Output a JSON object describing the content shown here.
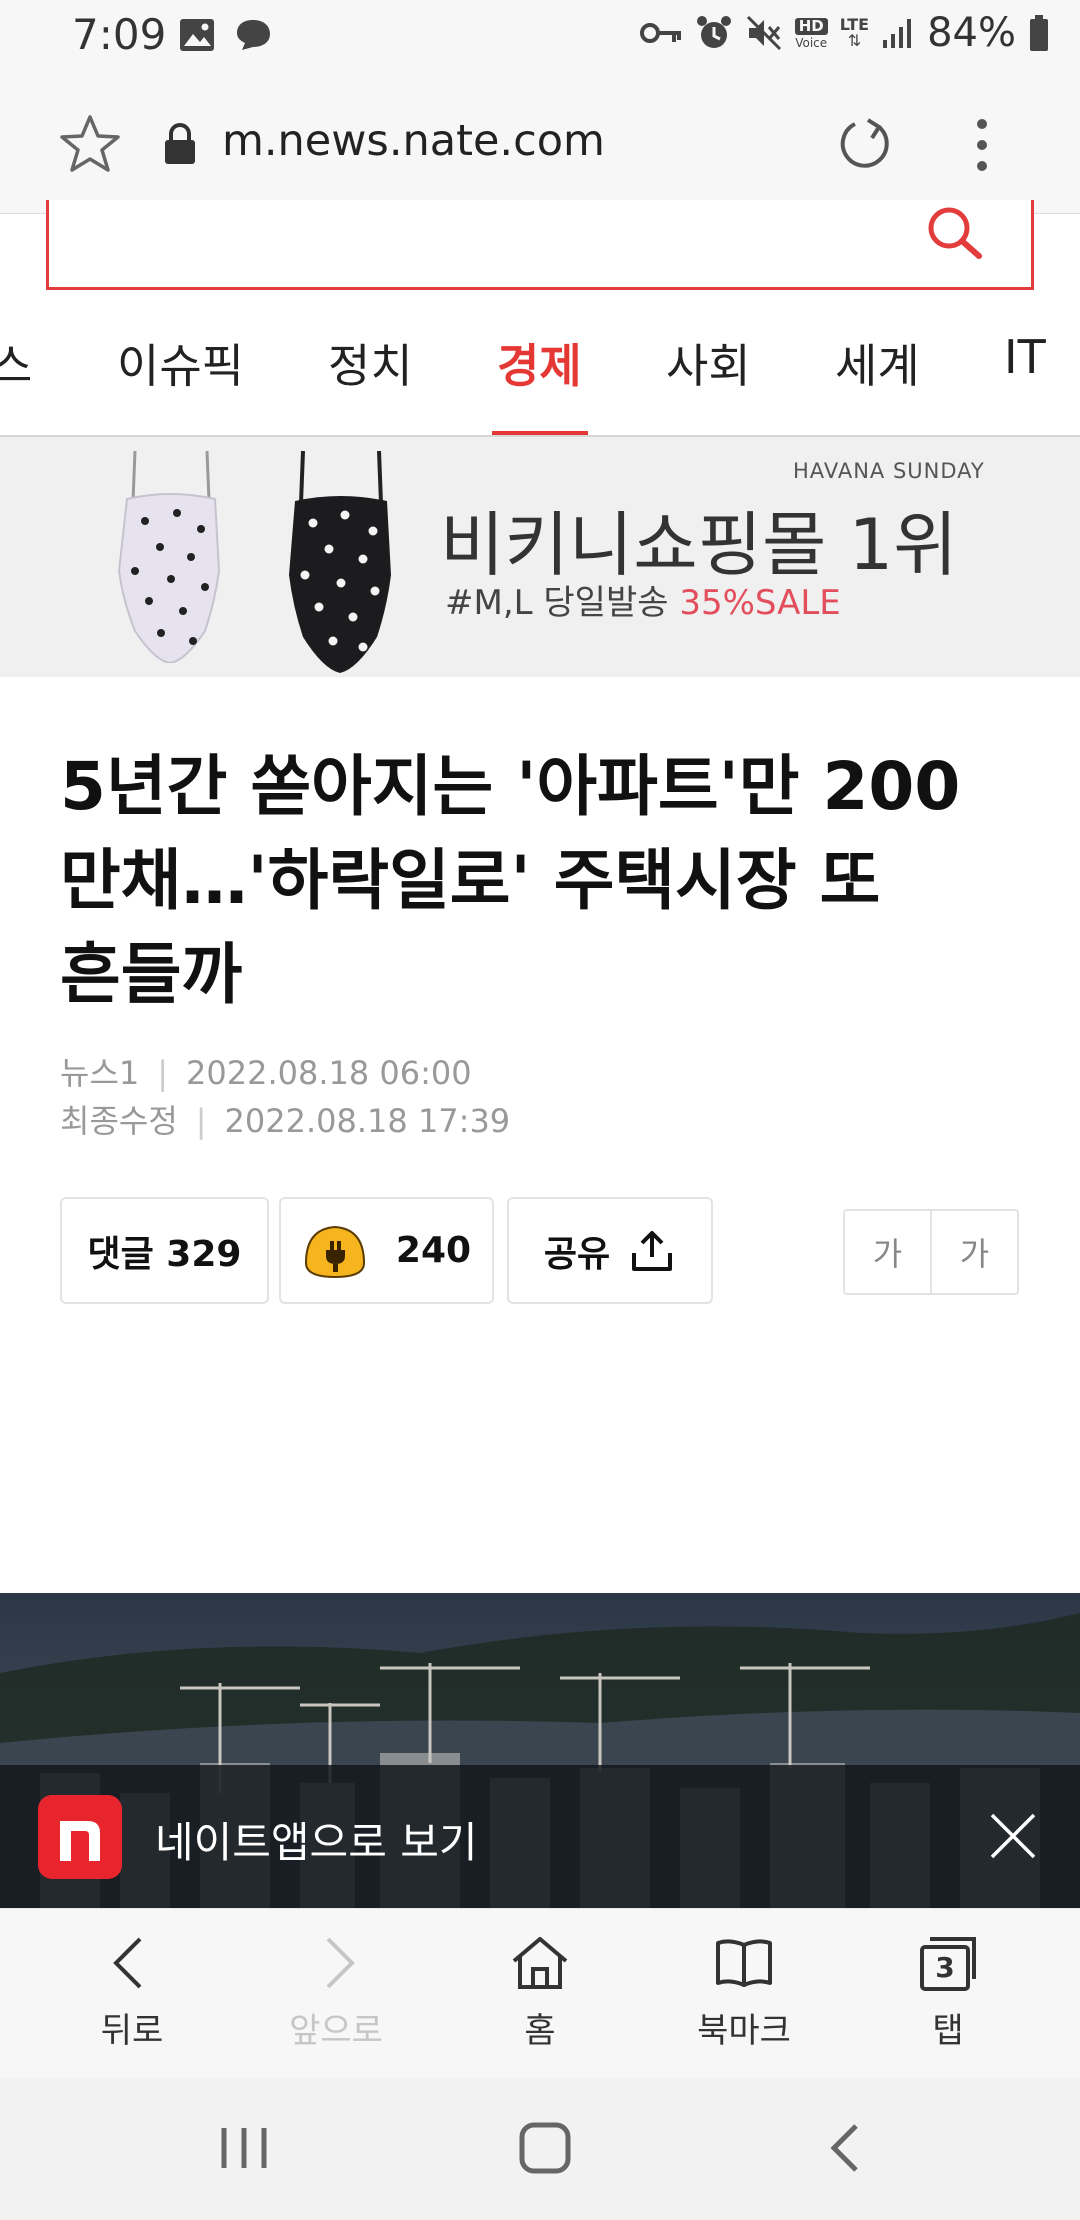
{
  "status_bar": {
    "time": "7:09",
    "battery": "84%",
    "left_icons": [
      "image-icon",
      "chat-bubble-icon"
    ],
    "right_icons": [
      "key-icon",
      "alarm-icon",
      "mute-icon",
      "hd-voice-icon",
      "lte-icon",
      "signal-icon",
      "battery-icon"
    ],
    "hd_text": "HD",
    "voice_text": "Voice",
    "lte_text": "LTE"
  },
  "browser": {
    "url": "m.news.nate.com"
  },
  "categories": [
    {
      "label": "스",
      "active": false
    },
    {
      "label": "이슈픽",
      "active": false
    },
    {
      "label": "정치",
      "active": false
    },
    {
      "label": "경제",
      "active": true
    },
    {
      "label": "사회",
      "active": false
    },
    {
      "label": "세계",
      "active": false
    },
    {
      "label": "IT",
      "active": false
    }
  ],
  "ad": {
    "brand": "HAVANA SUNDAY",
    "title": "비키니쇼핑몰 1위",
    "subtitle": "#M,L 당일발송 ",
    "sale": "35%SALE"
  },
  "article": {
    "title_lines": [
      "5년간 쏟아지는 '아파트'만 200",
      "만채…'하락일로' 주택시장 또",
      "흔들까"
    ],
    "source": "뉴스1",
    "published": "2022.08.18 06:00",
    "modified_label": "최종수정",
    "modified": "2022.08.18 17:39"
  },
  "actions": {
    "comments": "댓글 329",
    "reaction_count": "240",
    "share": "공유",
    "font_small": "가",
    "font_large": "가"
  },
  "app_banner": {
    "text": "네이트앱으로 보기"
  },
  "bottom_bar": {
    "back": "뒤로",
    "forward": "앞으로",
    "home": "홈",
    "bookmarks": "북마크",
    "tabs": "탭",
    "tab_count": "3"
  },
  "colors": {
    "accent": "#e53835",
    "ad_sale": "#e24e5c",
    "app_logo": "#e8242c"
  }
}
